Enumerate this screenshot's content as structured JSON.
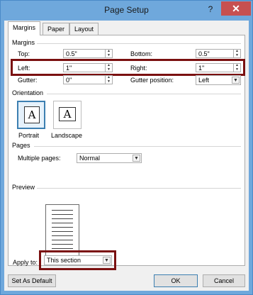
{
  "window": {
    "title": "Page Setup",
    "help": "?",
    "close": "✕"
  },
  "tabs": [
    {
      "label": "Margins"
    },
    {
      "label": "Paper"
    },
    {
      "label": "Layout"
    }
  ],
  "margins": {
    "section_label": "Margins",
    "top_label": "Top:",
    "top_value": "0.5\"",
    "bottom_label": "Bottom:",
    "bottom_value": "0.5\"",
    "left_label": "Left:",
    "left_value": "1\"",
    "right_label": "Right:",
    "right_value": "1\"",
    "gutter_label": "Gutter:",
    "gutter_value": "0\"",
    "gutter_position_label": "Gutter position:",
    "gutter_position_value": "Left"
  },
  "orientation": {
    "section_label": "Orientation",
    "portrait_label": "Portrait",
    "landscape_label": "Landscape",
    "icon_letter": "A",
    "selected": "Portrait"
  },
  "pages": {
    "section_label": "Pages",
    "multiple_pages_label": "Multiple pages:",
    "multiple_pages_value": "Normal"
  },
  "preview": {
    "section_label": "Preview",
    "apply_to_label": "Apply to:",
    "apply_to_value": "This section"
  },
  "buttons": {
    "set_as_default": "Set As Default",
    "ok": "OK",
    "cancel": "Cancel"
  },
  "colors": {
    "titlebar": "#6fa8dc",
    "close": "#c75050",
    "highlight": "#7a1010",
    "selected_border": "#3c7fb1"
  }
}
